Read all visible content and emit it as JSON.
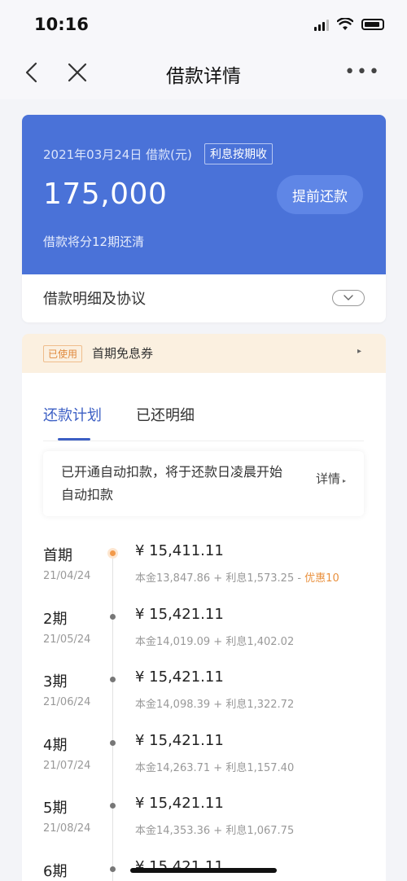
{
  "status_bar": {
    "time": "10:16"
  },
  "nav": {
    "title": "借款详情",
    "more": "•••"
  },
  "loan": {
    "date_line": "2021年03月24日 借款(元)",
    "interest_tag": "利息按期收",
    "amount": "175,000",
    "prepay_label": "提前还款",
    "installment_note": "借款将分12期还清",
    "detail_label": "借款明细及协议"
  },
  "coupon": {
    "status_tag": "已使用",
    "name": "首期免息券"
  },
  "tabs": {
    "plan": "还款计划",
    "paid": "已还明细"
  },
  "autopay": {
    "message": "已开通自动扣款，将于还款日凌晨开始自动扣款",
    "link_label": "详情"
  },
  "periods": [
    {
      "name": "首期",
      "date": "21/04/24",
      "amount": "¥ 15,411.11",
      "breakdown": "本金13,847.86 + 利息1,573.25 - ",
      "discount": "优惠10",
      "current": true
    },
    {
      "name": "2期",
      "date": "21/05/24",
      "amount": "¥ 15,421.11",
      "breakdown": "本金14,019.09 + 利息1,402.02"
    },
    {
      "name": "3期",
      "date": "21/06/24",
      "amount": "¥ 15,421.11",
      "breakdown": "本金14,098.39 + 利息1,322.72"
    },
    {
      "name": "4期",
      "date": "21/07/24",
      "amount": "¥ 15,421.11",
      "breakdown": "本金14,263.71 + 利息1,157.40"
    },
    {
      "name": "5期",
      "date": "21/08/24",
      "amount": "¥ 15,421.11",
      "breakdown": "本金14,353.36 + 利息1,067.75"
    },
    {
      "name": "6期",
      "date": "",
      "amount": "¥ 15,421.11",
      "breakdown": ""
    }
  ],
  "colors": {
    "brand_blue": "#4a72d8",
    "tab_active": "#3c5fc4",
    "discount_orange": "#e9913f"
  }
}
